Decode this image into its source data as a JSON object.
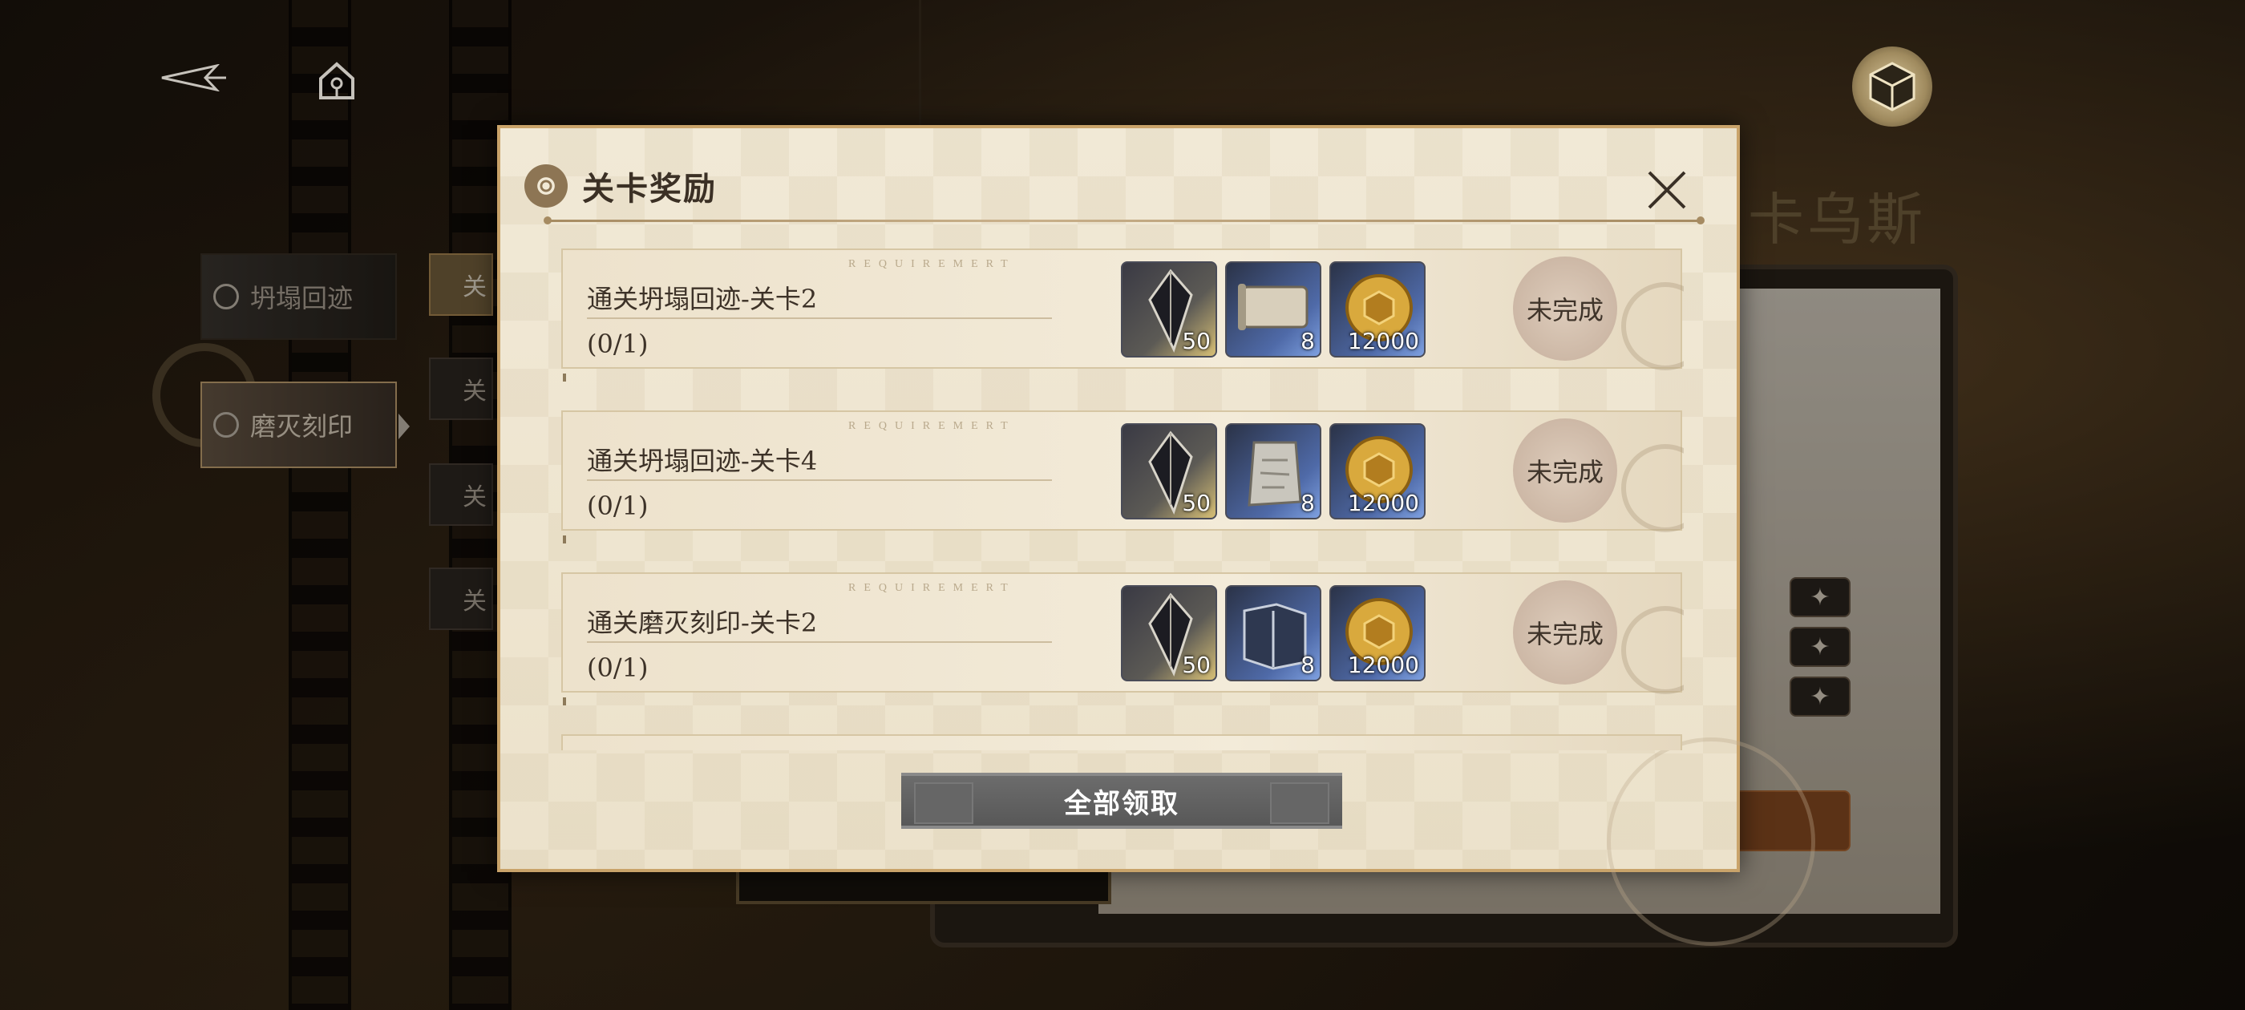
{
  "background": {
    "title": "卡乌斯",
    "side_tabs": [
      {
        "label": "坍塌回迹",
        "active": false
      },
      {
        "label": "磨灭刻印",
        "active": true
      }
    ],
    "mini_tabs": [
      {
        "label": "关",
        "active": true
      },
      {
        "label": "关",
        "active": false
      },
      {
        "label": "关",
        "active": false
      },
      {
        "label": "关",
        "active": false
      }
    ],
    "star_buttons": [
      "✦",
      "✦",
      "✦"
    ]
  },
  "nav": {
    "back_icon": "back-arrow-icon",
    "home_icon": "home-icon",
    "box_icon": "cube-box-icon"
  },
  "modal": {
    "title": "关卡奖励",
    "requirement_caption": "REQUIREMERT",
    "claim_all_label": "全部领取",
    "rows": [
      {
        "name": "通关坍塌回迹-关卡2",
        "progress": "(0/1)",
        "status": "未完成",
        "items": [
          {
            "icon": "crystal-shard-icon",
            "qty": "50",
            "frame": "gold"
          },
          {
            "icon": "scroll-icon",
            "qty": "8",
            "frame": "blue"
          },
          {
            "icon": "gold-coin-icon",
            "qty": "12000",
            "frame": "blue"
          }
        ]
      },
      {
        "name": "通关坍塌回迹-关卡4",
        "progress": "(0/1)",
        "status": "未完成",
        "items": [
          {
            "icon": "crystal-shard-icon",
            "qty": "50",
            "frame": "gold"
          },
          {
            "icon": "stone-tablet-icon",
            "qty": "8",
            "frame": "blue"
          },
          {
            "icon": "gold-coin-icon",
            "qty": "12000",
            "frame": "blue"
          }
        ]
      },
      {
        "name": "通关磨灭刻印-关卡2",
        "progress": "(0/1)",
        "status": "未完成",
        "items": [
          {
            "icon": "crystal-shard-icon",
            "qty": "50",
            "frame": "gold"
          },
          {
            "icon": "book-icon",
            "qty": "8",
            "frame": "blue"
          },
          {
            "icon": "gold-coin-icon",
            "qty": "12000",
            "frame": "blue"
          }
        ]
      }
    ]
  },
  "colors": {
    "accent_gold": "#c9a36a",
    "modal_paper": "#f1e9d6",
    "button_gray": "#6c6c6c"
  }
}
